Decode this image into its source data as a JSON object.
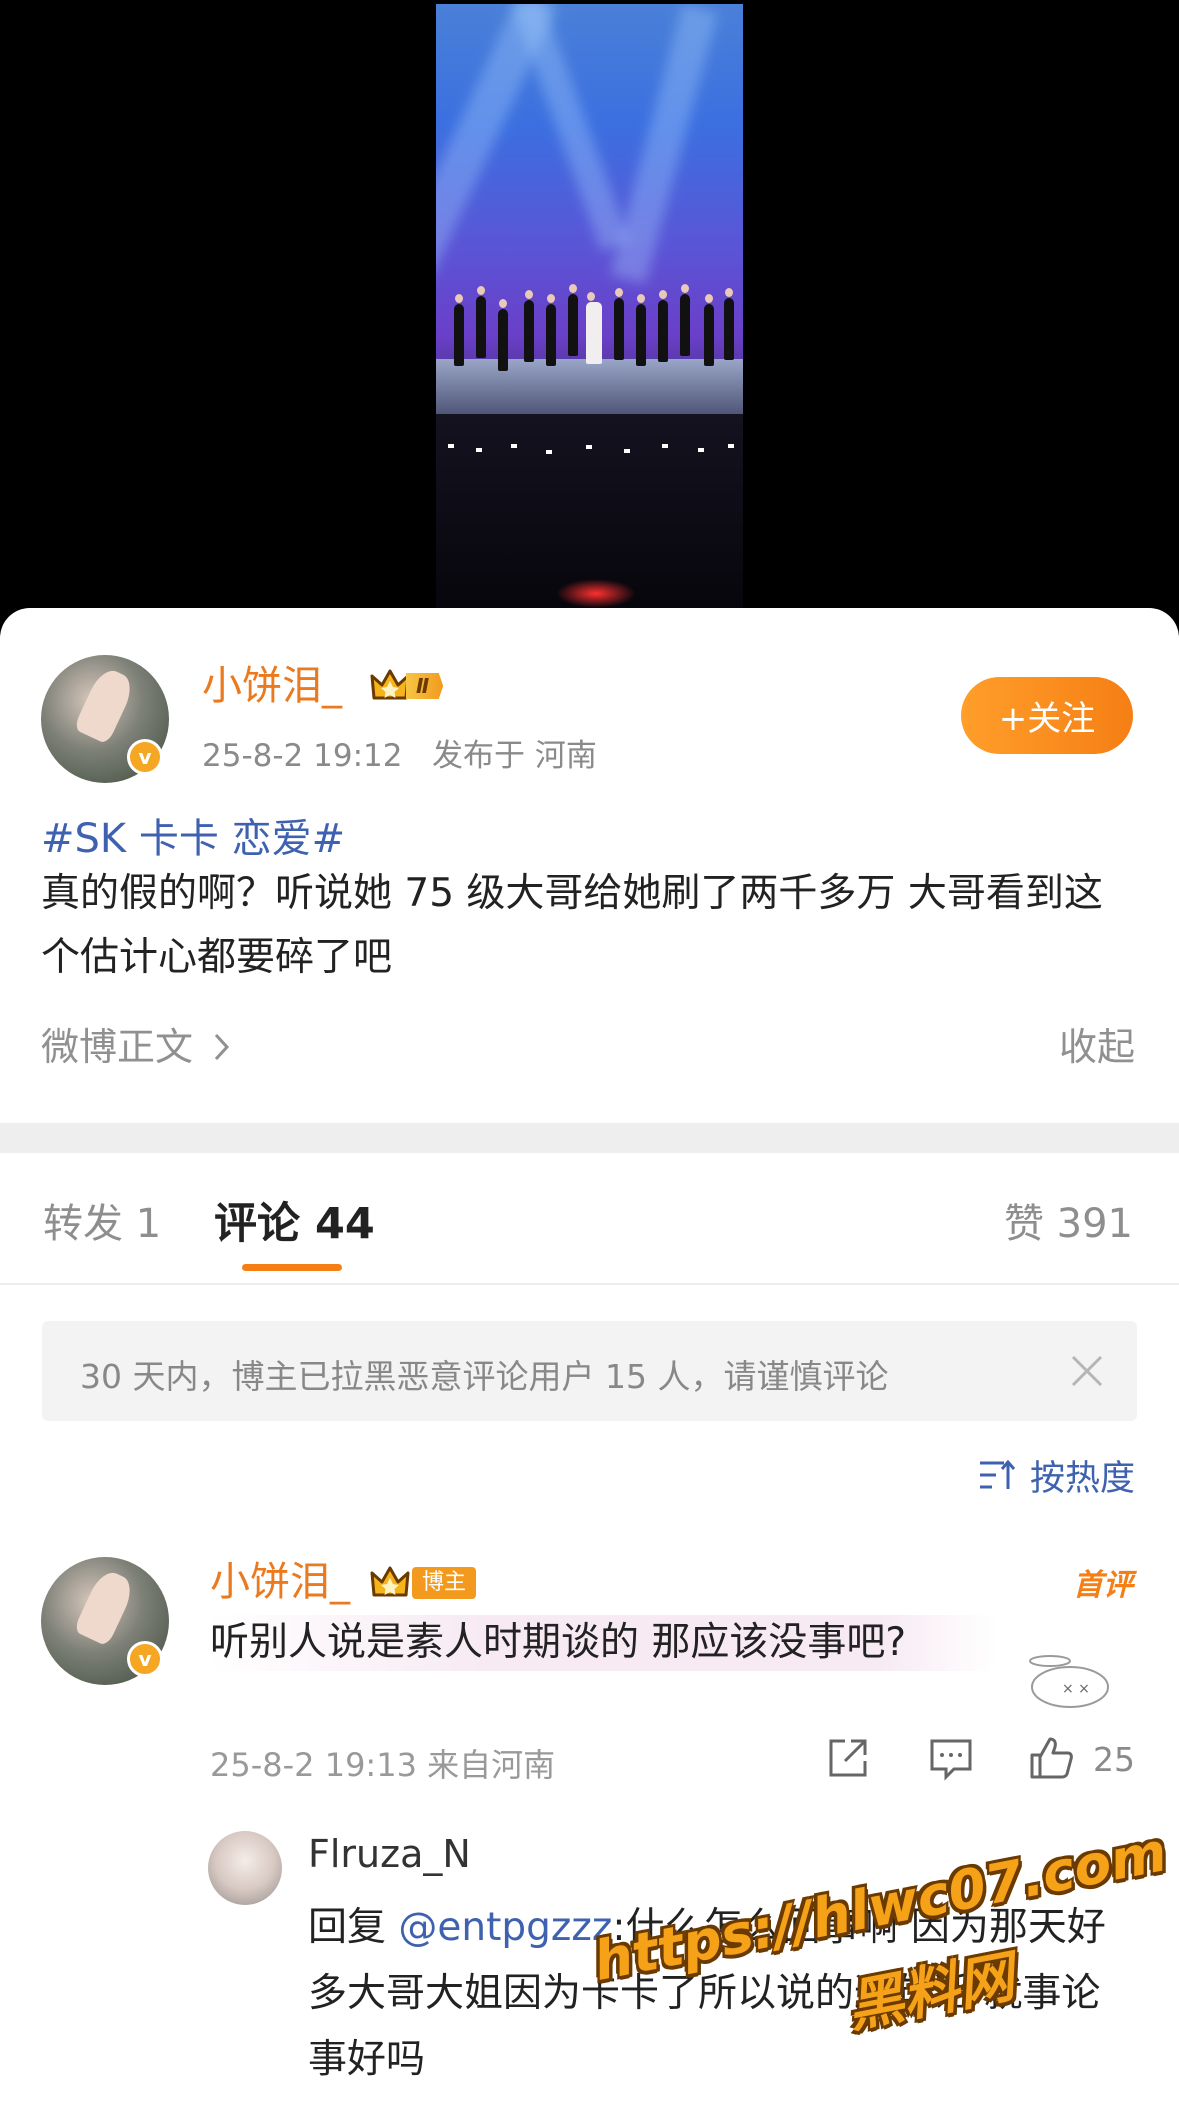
{
  "post": {
    "author": "小饼泪_",
    "level_badge": "Ⅱ",
    "verified_mark": "v",
    "time": "25-8-2 19:12",
    "location": "发布于 河南",
    "follow_label": "+关注",
    "hashtag": "#SK 卡卡 恋爱#",
    "text": "真的假的啊？听说她 75 级大哥给她刷了两千多万 大哥看到这个估计心都要碎了吧",
    "weibo_link": "微博正文",
    "collapse": "收起"
  },
  "tabs": {
    "repost": "转发 1",
    "comments": "评论 44",
    "likes": "赞 391"
  },
  "notice": "30 天内，博主已拉黑恶意评论用户 15 人，请谨慎评论",
  "sort_label": "按热度",
  "comment": {
    "author": "小饼泪_",
    "op_tag": "博主",
    "first_badge": "首评",
    "text": "听别人说是素人时期谈的 那应该没事吧?",
    "time_location": "25-8-2 19:13 来自河南",
    "like_count": "25"
  },
  "reply": {
    "author": "Flruza_N",
    "prefix": "回复 ",
    "mention": "@entpgzzz",
    "text": ":什么怎么回事啊 因为那天好多大哥大姐因为卡卡了所以说的这句话 就事论事好吗"
  },
  "watermark": {
    "url": "https://hlwc07.com",
    "name": "黑料网"
  },
  "colors": {
    "accent_orange": "#f57f14",
    "link_blue": "#3f62b0"
  },
  "icons": [
    "chevron-right-icon",
    "close-icon",
    "sort-icon",
    "share-icon",
    "comment-icon",
    "like-icon",
    "crown-icon"
  ]
}
